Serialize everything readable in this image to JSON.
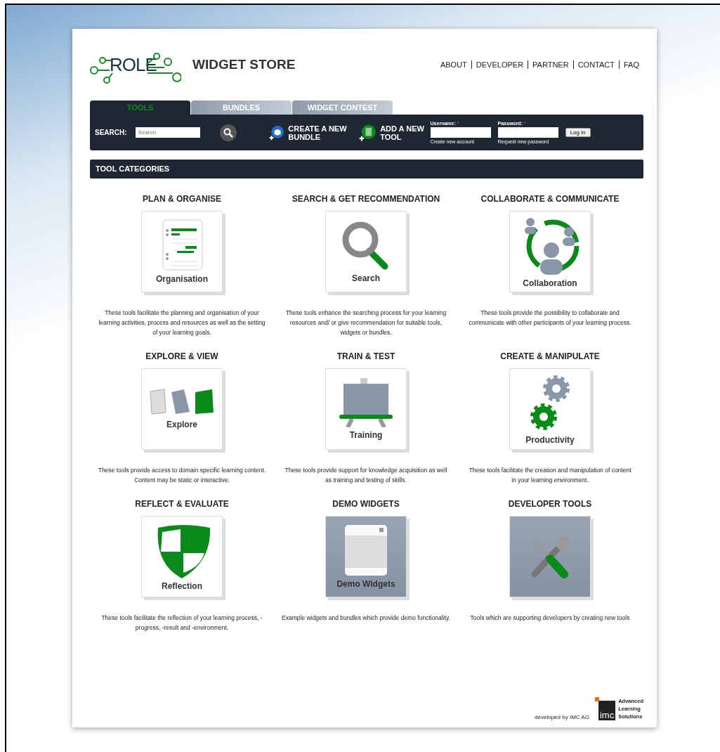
{
  "header": {
    "logo": "ROLE",
    "title": "WIDGET STORE",
    "nav": [
      "ABOUT",
      "DEVELOPER",
      "PARTNER",
      "CONTACT",
      "FAQ"
    ]
  },
  "tabs": [
    {
      "label": "TOOLS",
      "selected": true
    },
    {
      "label": "BUNDLES",
      "selected": false
    },
    {
      "label": "WIDGET CONTEST",
      "selected": false
    }
  ],
  "toolbar": {
    "search_label": "SEARCH:",
    "search": {
      "placeholder": "Search"
    },
    "actions": [
      "CREATE A NEW BUNDLE",
      "ADD A NEW TOOL"
    ],
    "login": {
      "username_label": "Username:",
      "password_label": "Password:",
      "required_mark": "*",
      "button": "Log in",
      "create_account": "Create new account",
      "request_password": "Request new password"
    }
  },
  "section_title": "TOOL CATEGORIES",
  "categories": [
    {
      "title": "PLAN & ORGANISE",
      "tile_label": "Organisation",
      "shaded": false,
      "description": "These tools facilitate the planning and organisation of your learning activities, process and resources as well as the setting of your learning goals."
    },
    {
      "title": "SEARCH & GET RECOMMENDATION",
      "tile_label": "Search",
      "shaded": false,
      "description": "These tools enhance the searching process for your learning resources and/ or give recommendation for suitable tools, widgets or bundles."
    },
    {
      "title": "COLLABORATE & COMMUNICATE",
      "tile_label": "Collaboration",
      "shaded": false,
      "description": "These tools provide the possibility to collaborate and communicate with other participants of your learning process."
    },
    {
      "title": "EXPLORE & VIEW",
      "tile_label": "Explore",
      "shaded": false,
      "description": "These tools provide access to domain specific learning content. Content may be static or interactive."
    },
    {
      "title": "TRAIN & TEST",
      "tile_label": "Training",
      "shaded": false,
      "description": "These tools provide support for knowledge acquisition as well as training and testing of skills."
    },
    {
      "title": "CREATE & MANIPULATE",
      "tile_label": "Productivity",
      "shaded": false,
      "description": "These tools facilitate the creation and manipulation of content in your learning environment."
    },
    {
      "title": "REFLECT & EVALUATE",
      "tile_label": "Reflection",
      "shaded": false,
      "description": "These tools facilitate the reflection of your learning process, -progress, -result and -environment."
    },
    {
      "title": "DEMO WIDGETS",
      "tile_label": "Demo Widgets",
      "shaded": true,
      "description": "Example widgets and bundles which provide demo functionality."
    },
    {
      "title": "DEVELOPER TOOLS",
      "shaded": true,
      "description": "Tools which are supporting developers by creating new tools"
    }
  ],
  "footer": {
    "credit": "developed by IMC AG",
    "imc_logo": "imc",
    "imc_tagline": [
      "Advanced",
      "Learning",
      "Solutions"
    ]
  }
}
